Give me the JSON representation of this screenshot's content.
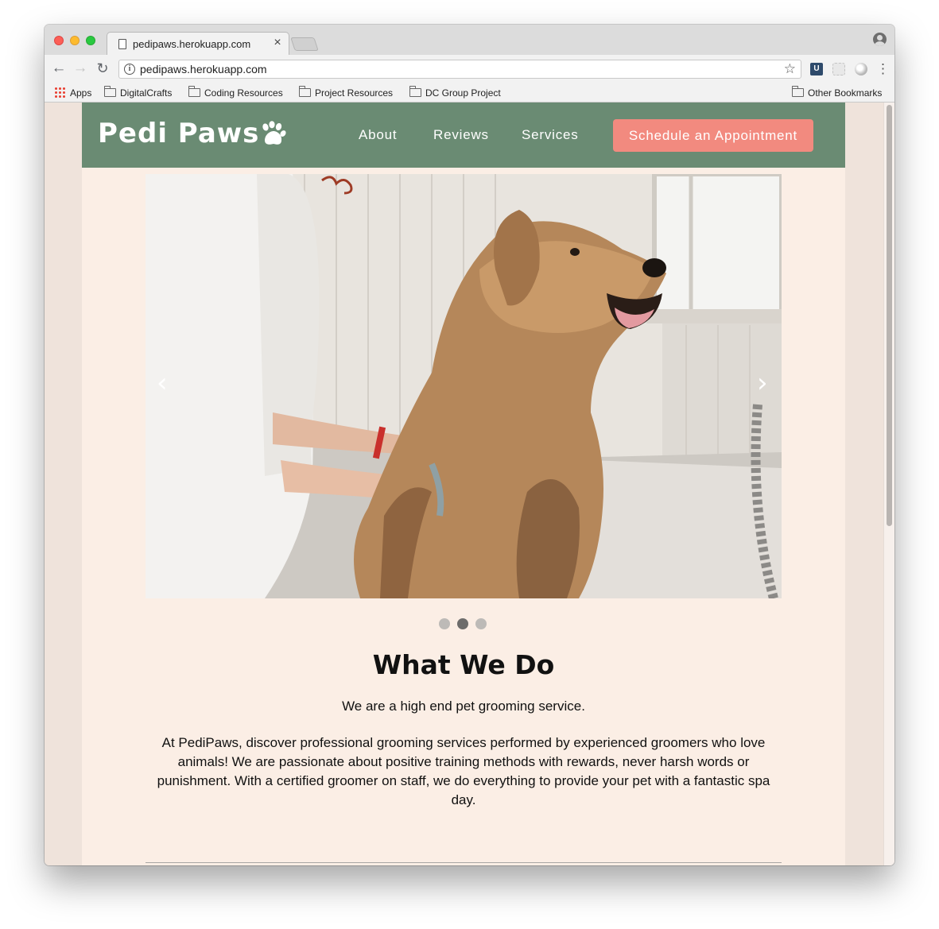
{
  "browser": {
    "tab_title": "pedipaws.herokuapp.com",
    "tab_close": "×",
    "url": "pedipaws.herokuapp.com",
    "bookmarks": [
      {
        "label": "Apps",
        "icon": "apps-grid-icon"
      },
      {
        "label": "DigitalCrafts",
        "icon": "folder-icon"
      },
      {
        "label": "Coding Resources",
        "icon": "folder-icon"
      },
      {
        "label": "Project Resources",
        "icon": "folder-icon"
      },
      {
        "label": "DC Group Project",
        "icon": "folder-icon"
      }
    ],
    "other_bookmarks": "Other Bookmarks",
    "ext_1_glyph": "U"
  },
  "site": {
    "logo": "Pedi Paws",
    "nav": [
      "About",
      "Reviews",
      "Services"
    ],
    "cta": "Schedule an Appointment",
    "brand_color": "#6a8b73",
    "cta_color": "#f28a7f",
    "page_bg": "#fbeee5"
  },
  "carousel": {
    "prev": "‹",
    "next": "›",
    "slide_count": 3,
    "active_index": 1
  },
  "about": {
    "title": "What We Do",
    "tagline": "We are a high end pet grooming service.",
    "description": "At PediPaws, discover professional grooming services performed by experienced groomers who love animals! We are passionate about positive training methods with rewards, never harsh words or punishment. With a certified groomer on staff, we do everything to provide your pet with a fantastic spa day."
  }
}
